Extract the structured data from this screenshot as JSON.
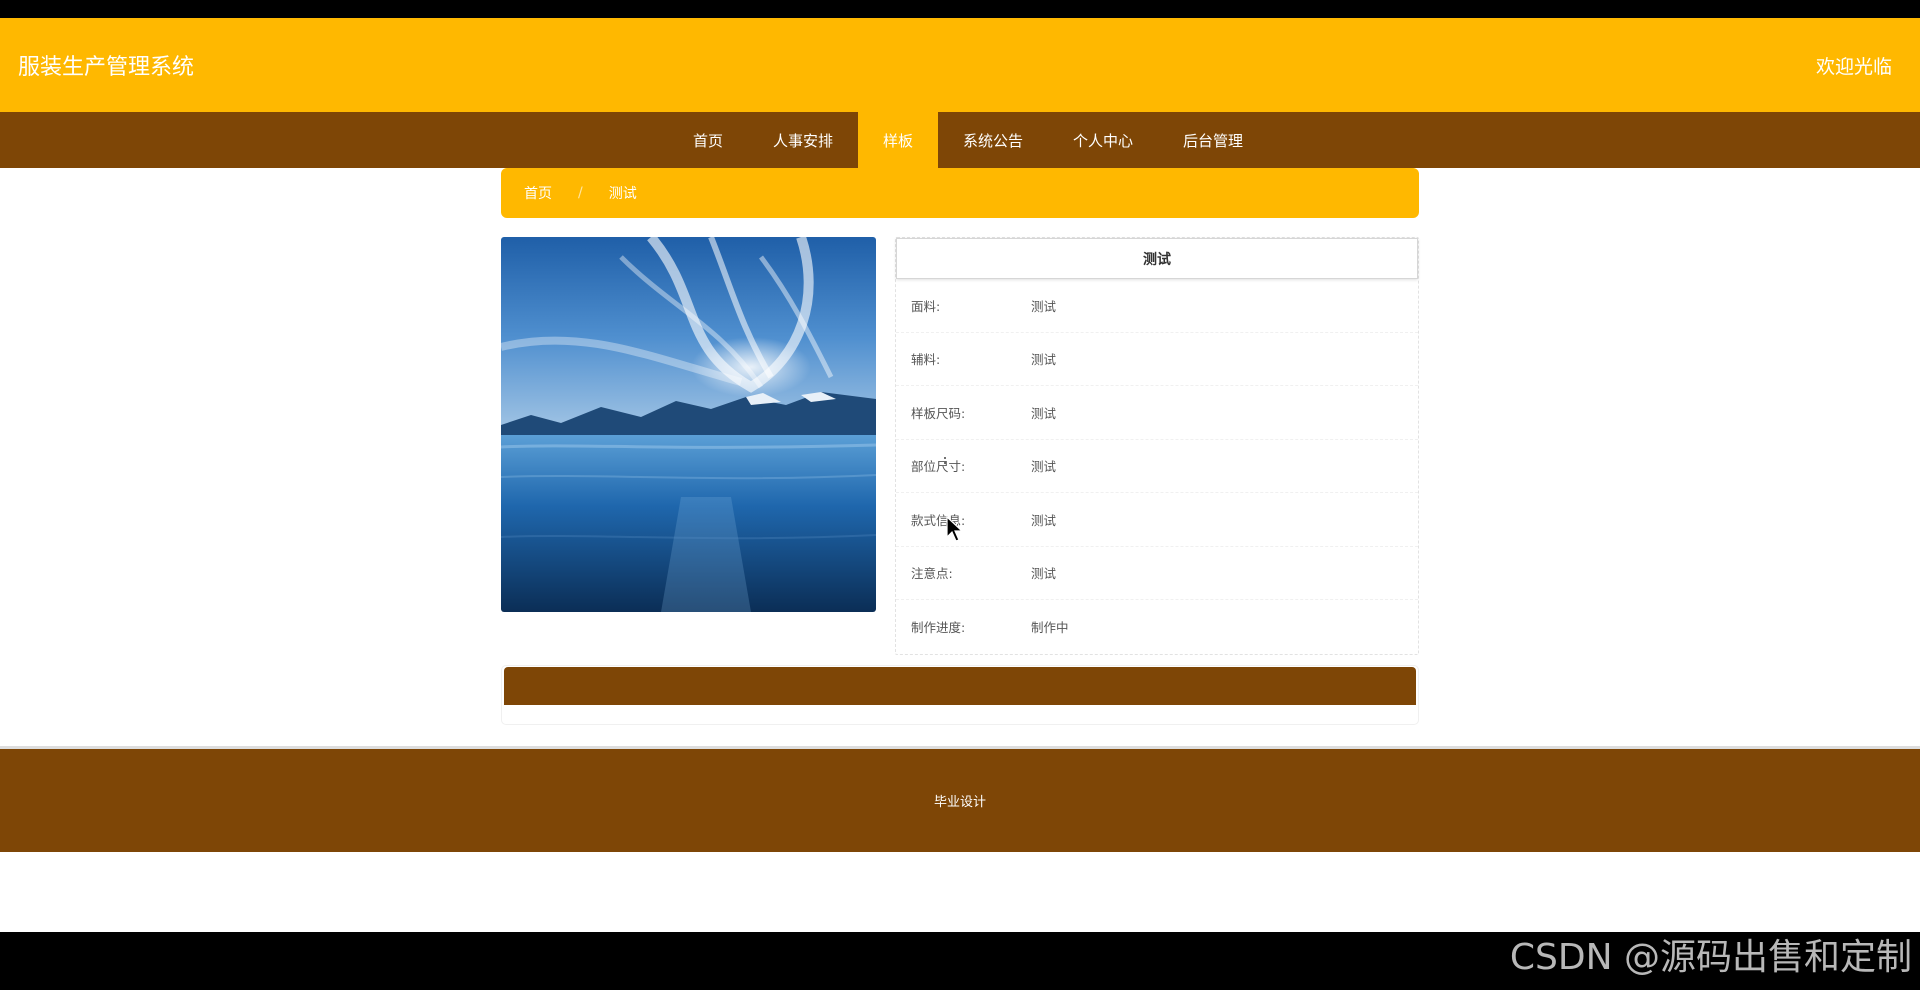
{
  "header": {
    "title": "服装生产管理系统",
    "welcome": "欢迎光临"
  },
  "nav": {
    "items": [
      {
        "label": "首页",
        "active": false
      },
      {
        "label": "人事安排",
        "active": false
      },
      {
        "label": "样板",
        "active": true
      },
      {
        "label": "系统公告",
        "active": false
      },
      {
        "label": "个人中心",
        "active": false
      },
      {
        "label": "后台管理",
        "active": false
      }
    ]
  },
  "breadcrumb": {
    "home": "首页",
    "separator": "/",
    "current": "测试"
  },
  "detail": {
    "title": "测试",
    "fields": [
      {
        "label": "面料:",
        "value": "测试"
      },
      {
        "label": "辅料:",
        "value": "测试"
      },
      {
        "label": "样板尺码:",
        "value": "测试"
      },
      {
        "label": "部位尺寸:",
        "value": "测试"
      },
      {
        "label": "款式信息:",
        "value": "测试"
      },
      {
        "label": "注意点:",
        "value": "测试"
      },
      {
        "label": "制作进度:",
        "value": "制作中"
      }
    ]
  },
  "footer": {
    "text": "毕业设计"
  },
  "watermark": "CSDN @源码出售和定制",
  "colors": {
    "accent": "#ffb800",
    "brown": "#7e4606"
  }
}
